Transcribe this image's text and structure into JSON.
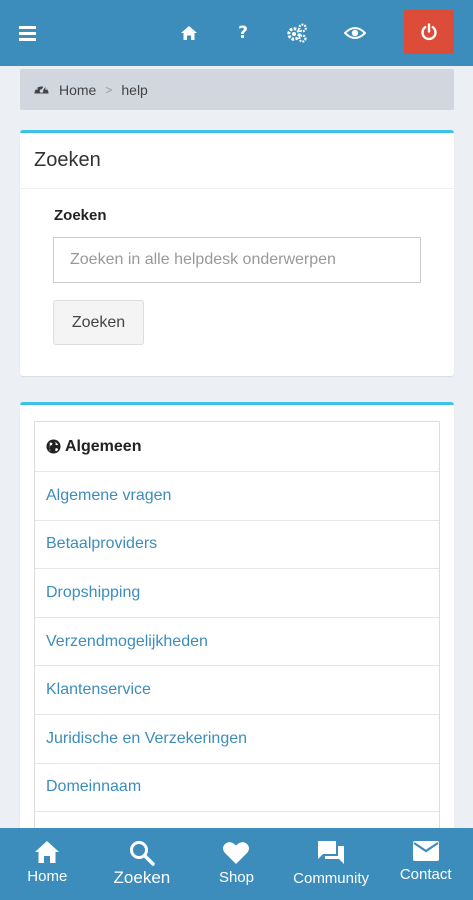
{
  "topbar": {
    "icons": {
      "menu": "hamburger-menu-icon",
      "home": "home-icon",
      "help": "?",
      "settings": "gears-icon",
      "preview": "eye-icon",
      "logout": "power-icon"
    },
    "colors": {
      "background": "#3c8dbc",
      "logout": "#dd4b39"
    }
  },
  "breadcrumb": {
    "icon": "dashboard-icon",
    "home": "Home",
    "separator": ">",
    "current": "help"
  },
  "search_box": {
    "title": "Zoeken",
    "label": "Zoeken",
    "placeholder": "Zoeken in alle helpdesk onderwerpen",
    "button": "Zoeken"
  },
  "categories": {
    "header": "Algemeen",
    "header_icon": "globe-icon",
    "items": [
      {
        "label": "Algemene vragen"
      },
      {
        "label": "Betaalproviders"
      },
      {
        "label": "Dropshipping"
      },
      {
        "label": "Verzendmogelijkheden"
      },
      {
        "label": "Klantenservice"
      },
      {
        "label": "Juridische en Verzekeringen"
      },
      {
        "label": "Domeinnaam"
      }
    ]
  },
  "bottom_nav": {
    "items": [
      {
        "label": "Home",
        "icon": "home-icon"
      },
      {
        "label": "Zoeken",
        "icon": "search-icon",
        "active": true
      },
      {
        "label": "Shop",
        "icon": "heart-icon"
      },
      {
        "label": "Community",
        "icon": "chat-icon"
      },
      {
        "label": "Contact",
        "icon": "mail-icon"
      }
    ]
  }
}
